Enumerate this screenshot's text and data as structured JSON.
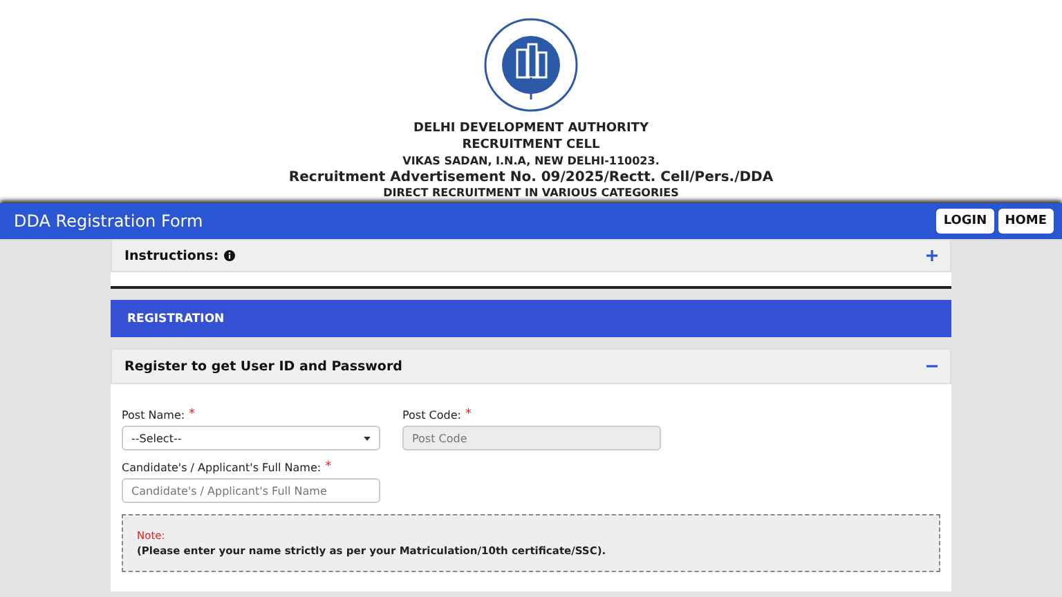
{
  "header": {
    "lines": [
      "DELHI DEVELOPMENT AUTHORITY",
      "RECRUITMENT CELL",
      "VIKAS SADAN, I.N.A, NEW DELHI-110023.",
      "Recruitment Advertisement No. 09/2025/Rectt. Cell/Pers./DDA",
      "DIRECT RECRUITMENT IN VARIOUS CATEGORIES"
    ]
  },
  "navbar": {
    "title": "DDA Registration Form",
    "buttons": [
      "LOGIN",
      "HOME"
    ]
  },
  "instructions": {
    "title": "Instructions:",
    "expanded": false
  },
  "registration_bar": {
    "title": "REGISTRATION"
  },
  "register_panel": {
    "title": "Register to get User ID and Password",
    "expanded": true,
    "fields": [
      {
        "kind": "select",
        "label": "Post Name:",
        "required_mark": "*",
        "value": "--Select--",
        "disabled": false
      },
      {
        "kind": "text",
        "label": "Post Code:",
        "required_mark": "*",
        "placeholder": "Post Code",
        "disabled": true
      },
      {
        "kind": "text",
        "label": "Candidate's / Applicant's Full Name:",
        "required_mark": "*",
        "placeholder": "Candidate's / Applicant's Full Name",
        "disabled": false
      }
    ],
    "note": {
      "title": "Note:",
      "text": "(Please enter your name strictly as per your Matriculation/10th certificate/SSC)."
    }
  }
}
